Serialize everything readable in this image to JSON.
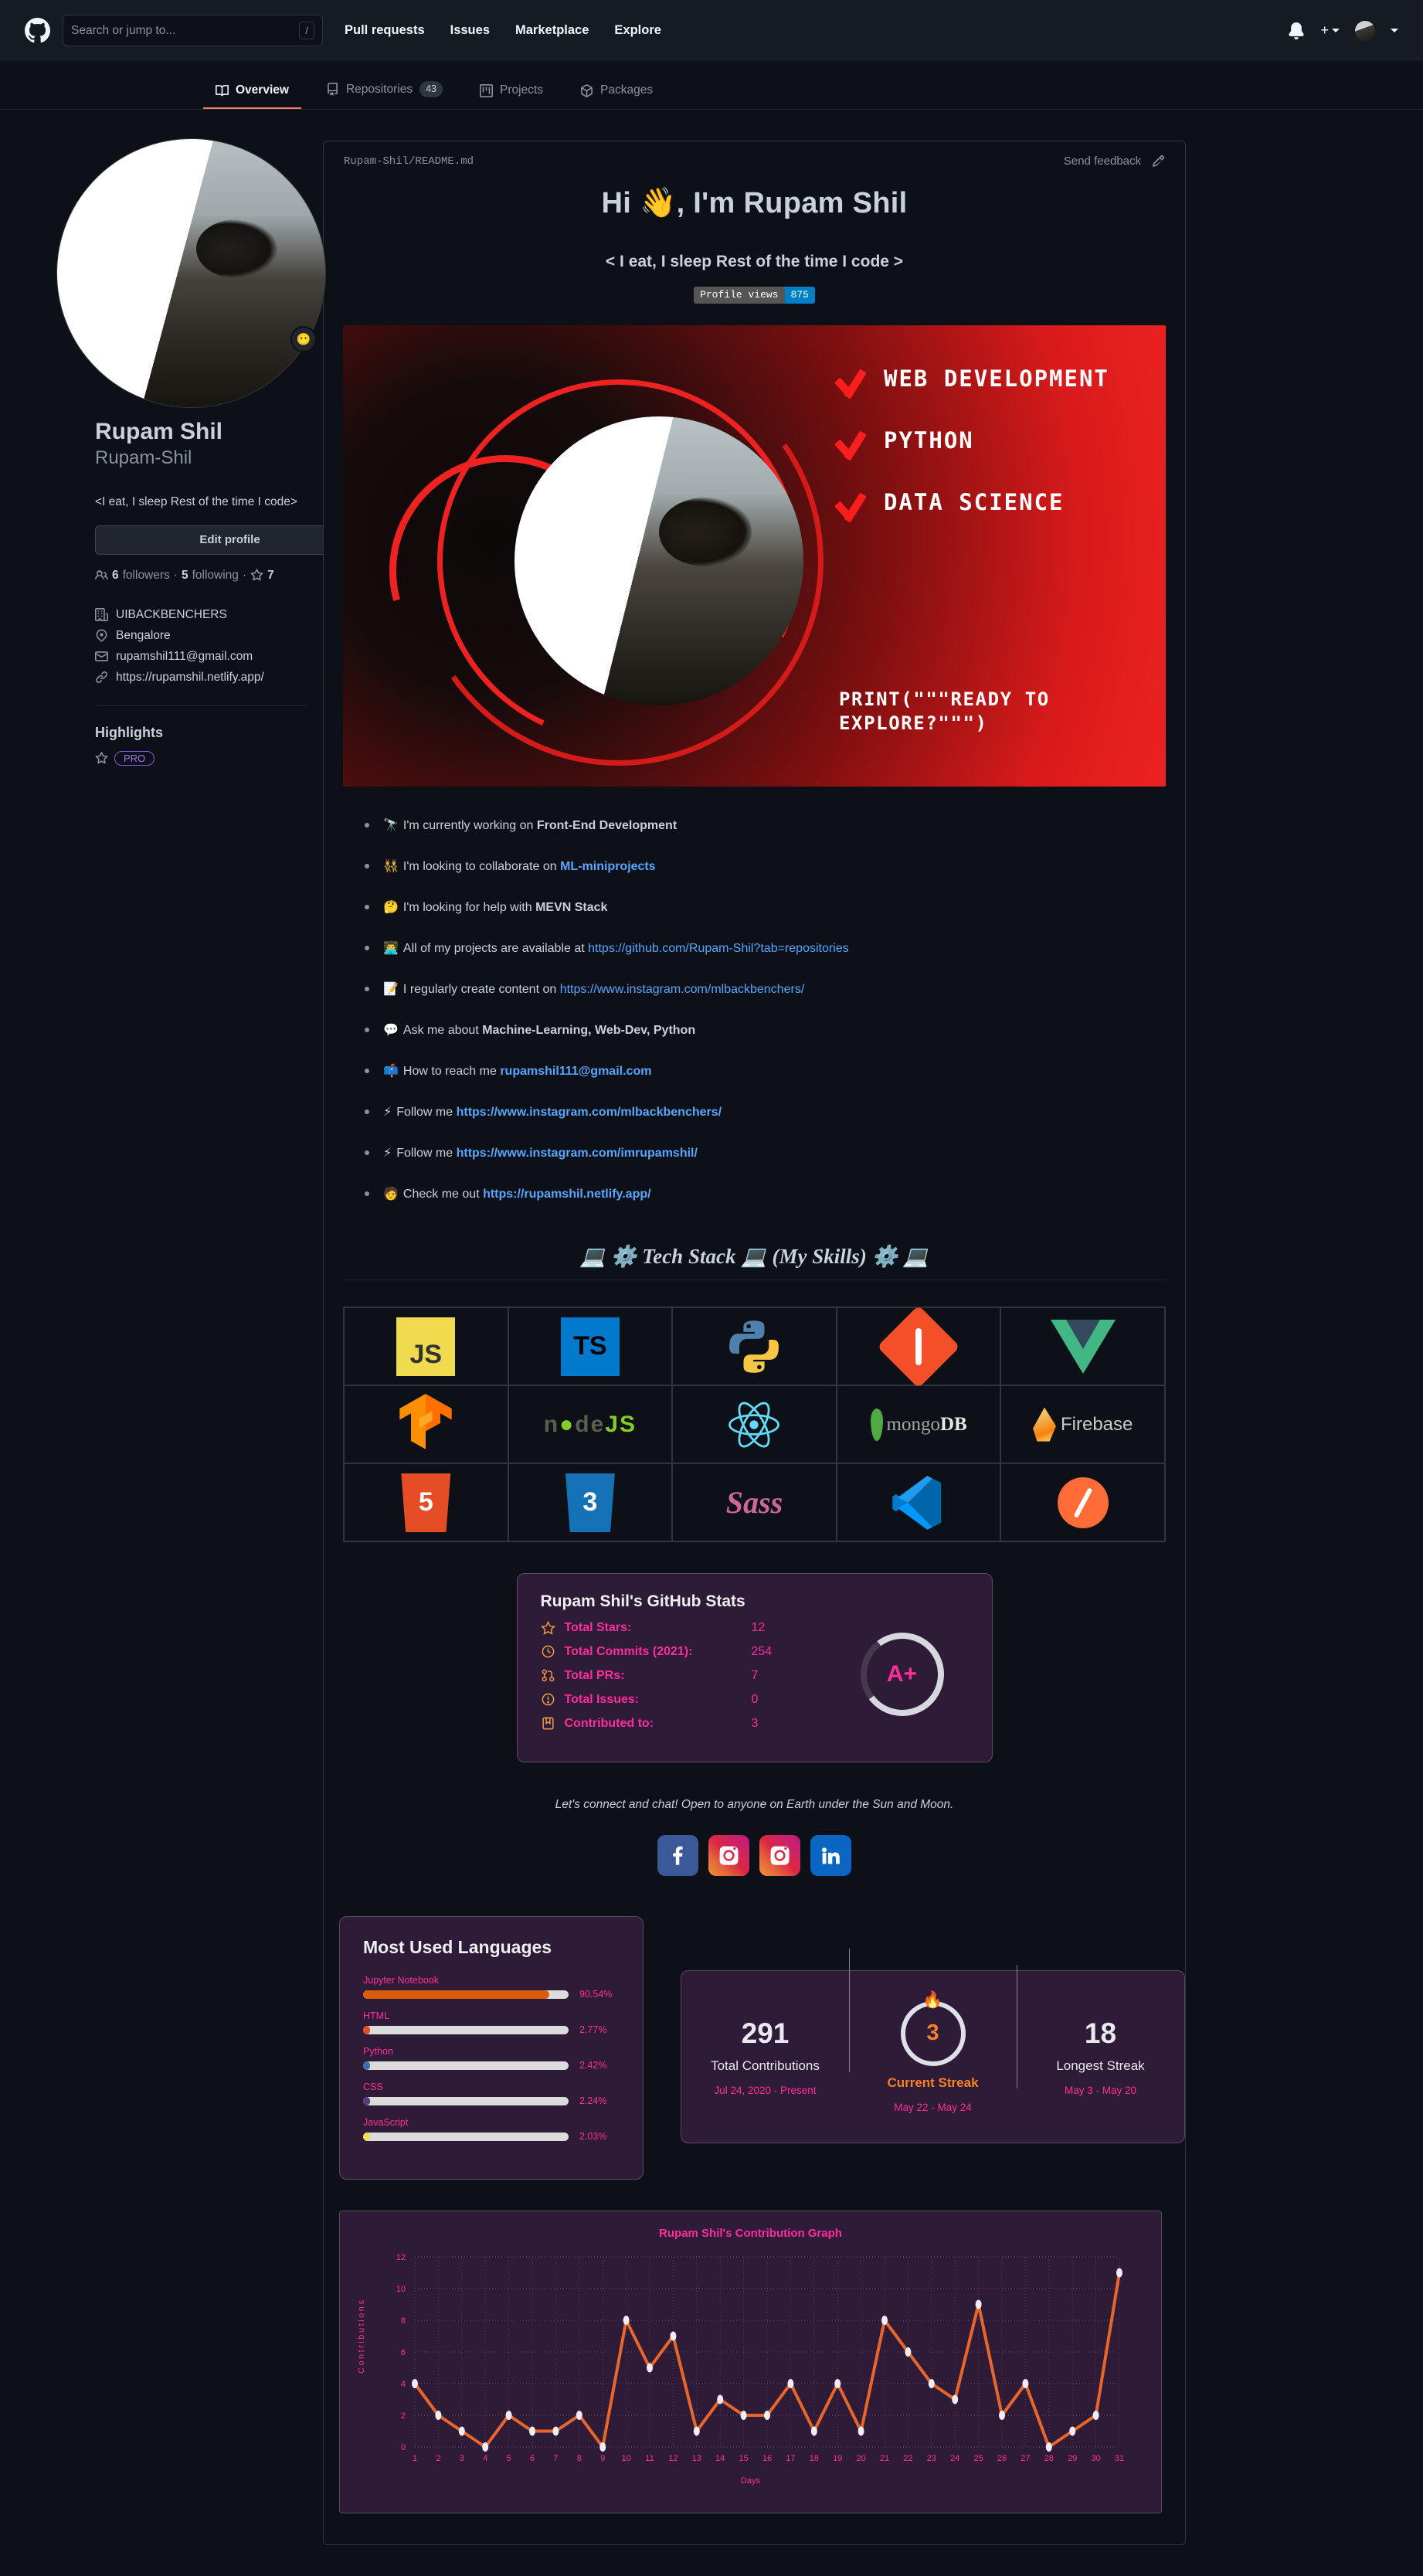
{
  "header": {
    "search_placeholder": "Search or jump to...",
    "slash_key": "/",
    "nav": [
      "Pull requests",
      "Issues",
      "Marketplace",
      "Explore"
    ]
  },
  "tabs": [
    {
      "label": "Overview",
      "icon": "book-icon",
      "count": null,
      "active": true
    },
    {
      "label": "Repositories",
      "icon": "repo-icon",
      "count": "43",
      "active": false
    },
    {
      "label": "Projects",
      "icon": "project-icon",
      "count": null,
      "active": false
    },
    {
      "label": "Packages",
      "icon": "package-icon",
      "count": null,
      "active": false
    }
  ],
  "sidebar": {
    "name": "Rupam Shil",
    "login": "Rupam-Shil",
    "bio": "<I eat, I sleep Rest of the time I code>",
    "edit_label": "Edit profile",
    "followers_count": "6",
    "followers_label": "followers",
    "following_count": "5",
    "following_label": "following",
    "stars_count": "7",
    "org": "UIBACKBENCHERS",
    "location": "Bengalore",
    "email": "rupamshil111@gmail.com",
    "website": "https://rupamshil.netlify.app/",
    "highlights_title": "Highlights",
    "pro_badge": "PRO"
  },
  "readme": {
    "breadcrumb_owner": "Rupam-Shil",
    "breadcrumb_sep": "/",
    "breadcrumb_file": "README.md",
    "feedback": "Send feedback",
    "h1": "Hi 👋, I'm Rupam Shil",
    "h3": "< I eat, I sleep Rest of the time I code >",
    "views_label": "Profile views",
    "views_count": "875"
  },
  "banner": {
    "items": [
      "WEB DEVELOPMENT",
      "PYTHON",
      "DATA SCIENCE"
    ],
    "footer": "PRINT(\"\"\"READY TO EXPLORE?\"\"\")"
  },
  "bullets": [
    {
      "emoji": "🔭",
      "pre": "I'm currently working on ",
      "strong": "Front-End Development",
      "link": null,
      "post": ""
    },
    {
      "emoji": "👯",
      "pre": "I'm looking to collaborate on ",
      "strong": null,
      "link": "ML-miniprojects",
      "link_bold": true,
      "post": ""
    },
    {
      "emoji": "🤔",
      "pre": "I'm looking for help with ",
      "strong": "MEVN Stack",
      "link": null,
      "post": ""
    },
    {
      "emoji": "👨‍💻",
      "pre": "All of my projects are available at ",
      "strong": null,
      "link": "https://github.com/Rupam-Shil?tab=repositories",
      "link_bold": false,
      "post": ""
    },
    {
      "emoji": "📝",
      "pre": "I regularly create content on ",
      "strong": null,
      "link": "https://www.instagram.com/mlbackbenchers/",
      "link_bold": false,
      "post": ""
    },
    {
      "emoji": "💬",
      "pre": "Ask me about ",
      "strong": "Machine-Learning, Web-Dev, Python",
      "link": null,
      "post": ""
    },
    {
      "emoji": "📫",
      "pre": "How to reach me ",
      "strong": null,
      "link": "rupamshil111@gmail.com",
      "link_bold": true,
      "post": ""
    },
    {
      "emoji": "⚡",
      "pre": "Follow me ",
      "strong": null,
      "link": "https://www.instagram.com/mlbackbenchers/",
      "link_bold": true,
      "post": ""
    },
    {
      "emoji": "⚡",
      "pre": "Follow me ",
      "strong": null,
      "link": "https://www.instagram.com/imrupamshil/",
      "link_bold": true,
      "post": ""
    },
    {
      "emoji": "🧑",
      "pre": "Check me out ",
      "strong": null,
      "link": "https://rupamshil.netlify.app/",
      "link_bold": true,
      "post": ""
    }
  ],
  "tech": {
    "heading": "💻 ⚙️ Tech Stack 💻 (My Skills) ⚙️ 💻",
    "items": [
      "javascript-icon",
      "typescript-icon",
      "python-icon",
      "git-icon",
      "vuejs-icon",
      "tensorflow-icon",
      "nodejs-icon",
      "react-icon",
      "mongodb-icon",
      "firebase-icon",
      "html5-icon",
      "css3-icon",
      "sass-icon",
      "vscode-icon",
      "postman-icon"
    ],
    "labels": {
      "js": "JS",
      "ts": "TS",
      "node": "node",
      "node_js": "JS",
      "mongo_pre": "mongo",
      "mongo_post": "DB",
      "firebase": "Firebase",
      "html": "5",
      "css": "3",
      "sass": "Sass"
    }
  },
  "stats": {
    "title": "Rupam Shil's GitHub Stats",
    "rows": [
      {
        "icon": "star-icon",
        "label": "Total Stars:",
        "value": "12"
      },
      {
        "icon": "clock-icon",
        "label": "Total Commits (2021):",
        "value": "254"
      },
      {
        "icon": "pr-icon",
        "label": "Total PRs:",
        "value": "7"
      },
      {
        "icon": "issue-icon",
        "label": "Total Issues:",
        "value": "0"
      },
      {
        "icon": "repo-icon",
        "label": "Contributed to:",
        "value": "3"
      }
    ],
    "rank": "A+"
  },
  "connect": {
    "text": "Let's connect and chat! Open to anyone on Earth under the Sun and Moon.",
    "socials": [
      "facebook-icon",
      "instagram-icon",
      "instagram-icon",
      "linkedin-icon"
    ]
  },
  "languages": {
    "title": "Most Used Languages",
    "items": [
      {
        "name": "Jupyter Notebook",
        "pct": "90.54%",
        "value": 90.54,
        "color": "#DA5B0B"
      },
      {
        "name": "HTML",
        "pct": "2.77%",
        "value": 2.77,
        "color": "#e34c26"
      },
      {
        "name": "Python",
        "pct": "2.42%",
        "value": 2.42,
        "color": "#3572A5"
      },
      {
        "name": "CSS",
        "pct": "2.24%",
        "value": 2.24,
        "color": "#563d7c"
      },
      {
        "name": "JavaScript",
        "pct": "2.03%",
        "value": 2.03,
        "color": "#f1e05a"
      }
    ]
  },
  "streak": {
    "total": "291",
    "total_label": "Total Contributions",
    "total_range": "Jul 24, 2020 - Present",
    "current": "3",
    "current_label": "Current Streak",
    "current_range": "May 22 - May 24",
    "longest": "18",
    "longest_label": "Longest Streak",
    "longest_range": "May 3 - May 20"
  },
  "chart_data": {
    "type": "line",
    "title": "Rupam Shil's Contribution Graph",
    "xlabel": "Days",
    "ylabel": "Contributions",
    "x": [
      1,
      2,
      3,
      4,
      5,
      6,
      7,
      8,
      9,
      10,
      11,
      12,
      13,
      14,
      15,
      16,
      17,
      18,
      19,
      20,
      21,
      22,
      23,
      24,
      25,
      26,
      27,
      28,
      29,
      30,
      31
    ],
    "values": [
      4,
      2,
      1,
      0,
      2,
      1,
      1,
      2,
      0,
      8,
      5,
      7,
      1,
      3,
      2,
      2,
      4,
      1,
      4,
      1,
      8,
      6,
      4,
      3,
      9,
      2,
      4,
      0,
      1,
      2,
      11
    ],
    "ylim": [
      0,
      12
    ],
    "yticks": [
      0,
      2,
      4,
      6,
      8,
      10,
      12
    ],
    "line_color": "#e8662b",
    "point_color": "#f0eef4",
    "grid": true,
    "legend": null
  }
}
